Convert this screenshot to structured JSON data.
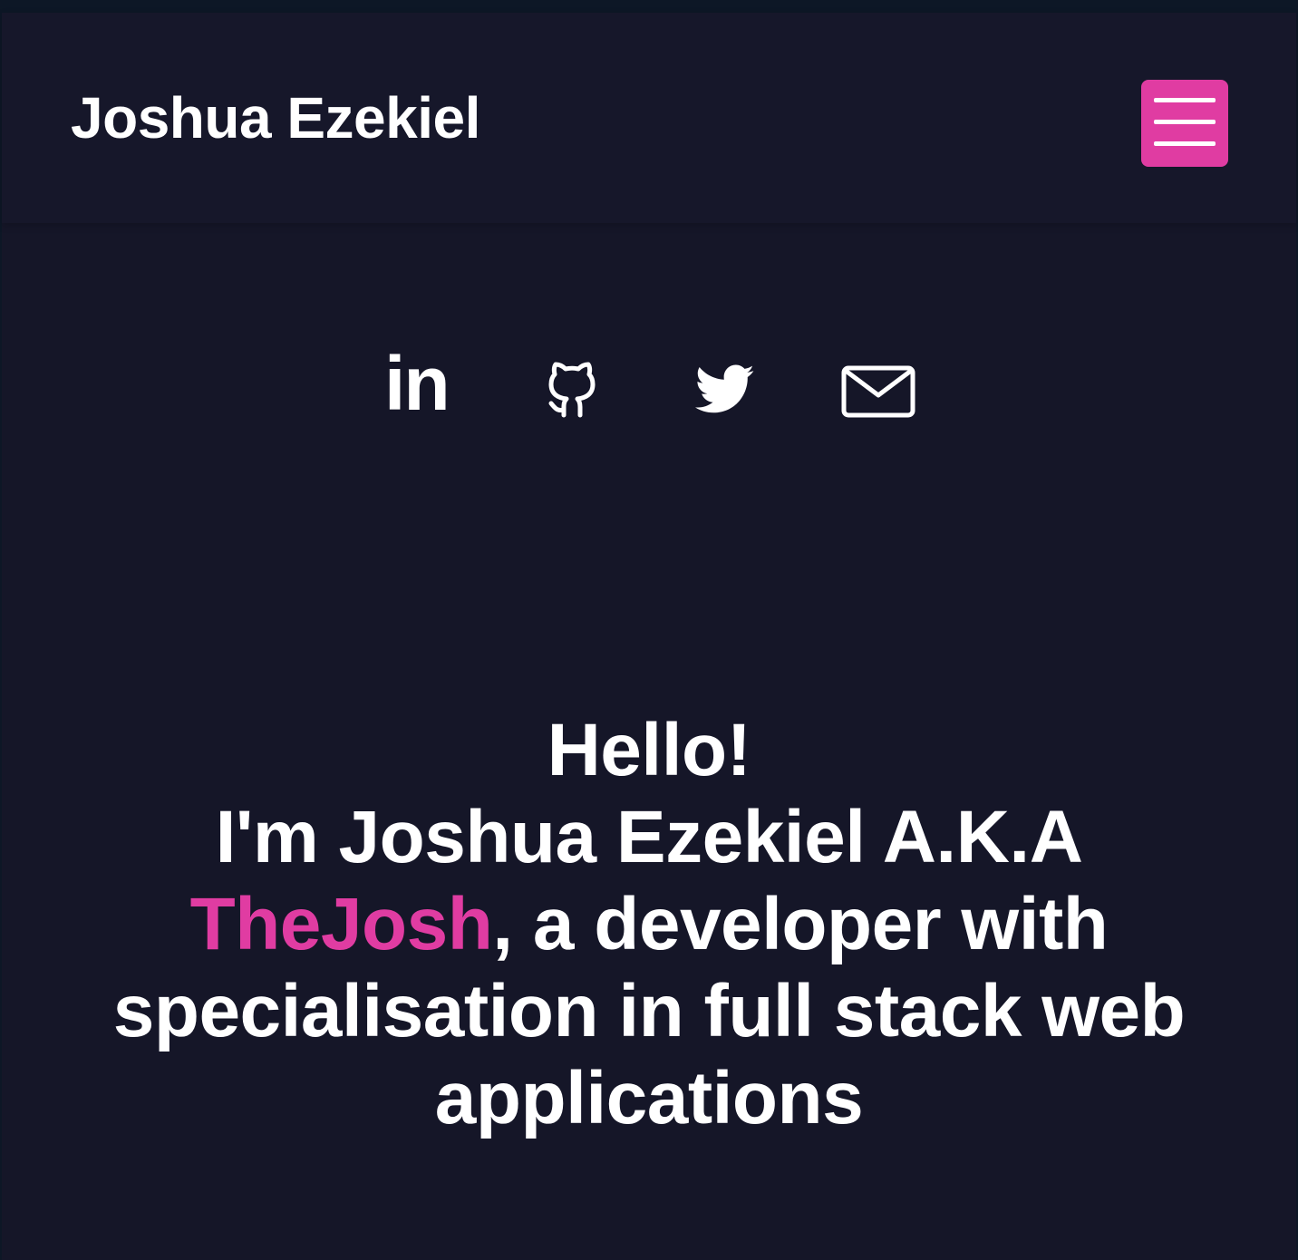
{
  "header": {
    "brand": "Joshua Ezekiel",
    "menu_icon": "hamburger-menu-icon",
    "accent_color": "#e03ca2"
  },
  "socials": {
    "linkedin_text": "in",
    "items": [
      {
        "name": "linkedin",
        "icon": "linkedin-icon"
      },
      {
        "name": "github",
        "icon": "github-icon"
      },
      {
        "name": "twitter",
        "icon": "twitter-icon"
      },
      {
        "name": "email",
        "icon": "mail-icon"
      }
    ]
  },
  "hero": {
    "greeting": "Hello!",
    "intro": "I'm Joshua Ezekiel A.K.A",
    "alias": "TheJosh",
    "description_line1": ", a developer with",
    "description_line2": "specialisation in full stack web",
    "description_line3": "applications"
  },
  "colors": {
    "background": "#151628",
    "text": "#ffffff",
    "accent": "#e03ca2"
  }
}
